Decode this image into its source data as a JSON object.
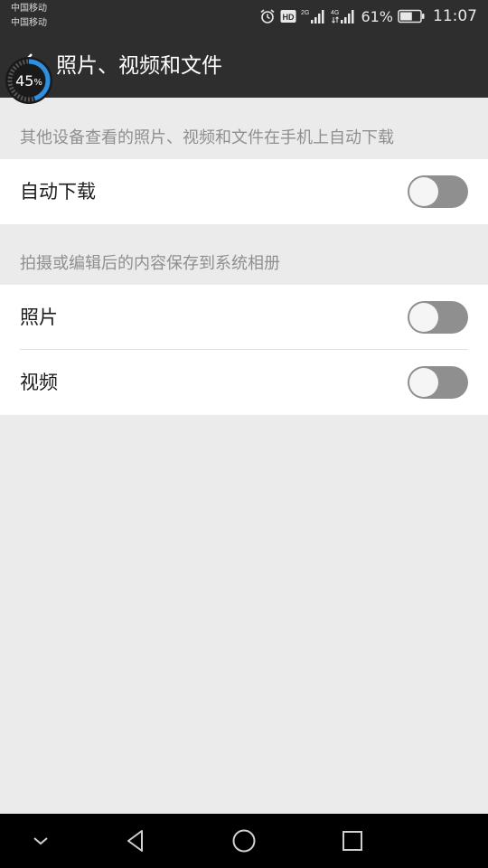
{
  "status_bar": {
    "carrier_1": "中国移动",
    "carrier_2": "中国移动",
    "hd_badge": "HD",
    "network_1": "2G",
    "network_2": "4G",
    "battery_percent": "61%",
    "battery_level": 0.61,
    "time": "11:07",
    "icons": [
      "alarm-icon",
      "hd-icon",
      "signal-icon",
      "battery-icon"
    ]
  },
  "header": {
    "title": "照片、视频和文件",
    "back_icon": "back-arrow-icon"
  },
  "progress_overlay": {
    "value": "45",
    "unit": "%",
    "level": 0.45
  },
  "sections": {
    "download": {
      "header": "其他设备查看的照片、视频和文件在手机上自动下载",
      "rows": [
        {
          "label": "自动下载",
          "enabled": false
        }
      ]
    },
    "save": {
      "header": "拍摄或编辑后的内容保存到系统相册",
      "rows": [
        {
          "label": "照片",
          "enabled": false
        },
        {
          "label": "视频",
          "enabled": false
        }
      ]
    }
  },
  "nav_bar": {
    "icons": [
      "chevron-down-icon",
      "back-triangle-icon",
      "home-circle-icon",
      "recents-square-icon"
    ]
  },
  "colors": {
    "bar_background": "#2e2e2e",
    "page_background": "#ebebeb",
    "toggle_off": "#8f8f8f",
    "progress_ring": "#2f8fe0"
  }
}
